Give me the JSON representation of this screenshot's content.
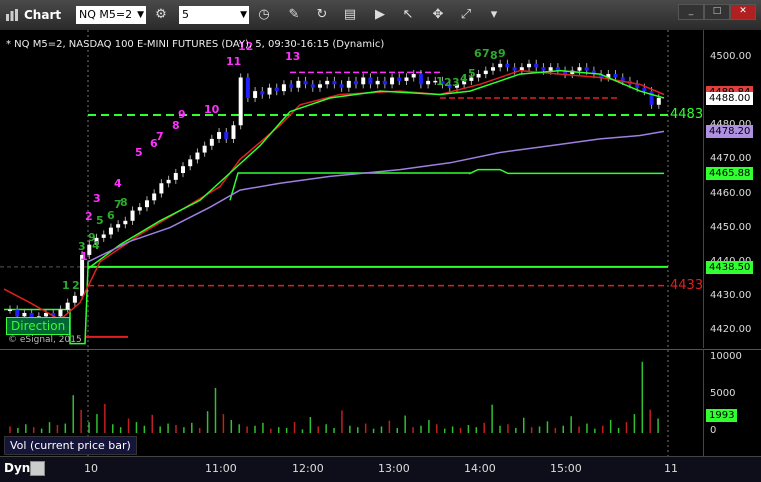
{
  "window": {
    "title": "Chart",
    "symbol": "NQ M5=2",
    "interval": "5"
  },
  "chart": {
    "header": "* NQ M5=2, NASDAQ 100 E-MINI FUTURES (DAY), 5, 09:30-16:15 (Dynamic)",
    "direction_button": "Direction",
    "copyright": "© eSignal, 2015",
    "price_ticks": [
      "4500.00",
      "4490.00",
      "4480.00",
      "4470.00",
      "4460.00",
      "4450.00",
      "4440.00",
      "4430.00",
      "4420.00"
    ],
    "price_badges": [
      {
        "text": "4489.84",
        "color": "#e04040",
        "price": 4489.84
      },
      {
        "text": "4488.00",
        "color": "#ffffff",
        "price": 4488.0
      },
      {
        "text": "4478.20",
        "color": "#b090e0",
        "price": 4478.2
      },
      {
        "text": "4465.88",
        "color": "#30ff30",
        "price": 4465.88
      },
      {
        "text": "4438.50",
        "color": "#30ff30",
        "price": 4438.5
      }
    ],
    "level_labels": [
      {
        "text": "4483",
        "color": "#30ff30",
        "price": 4483
      },
      {
        "text": "4433",
        "color": "#e02020",
        "price": 4433
      }
    ],
    "time_labels": [
      "10",
      "11:00",
      "12:00",
      "13:00",
      "14:00",
      "15:00",
      "11"
    ],
    "magenta_counts": [
      "1",
      "2",
      "3",
      "4",
      "5",
      "6",
      "7",
      "8",
      "9",
      "10",
      "11",
      "12",
      "13"
    ],
    "green_counts_a": [
      "1",
      "2",
      "3",
      "4",
      "5",
      "6",
      "7",
      "8",
      "9"
    ],
    "green_counts_b": [
      "1",
      "2",
      "3",
      "4",
      "5",
      "6",
      "7",
      "8",
      "9"
    ]
  },
  "volume": {
    "label": "Vol (current price bar)",
    "ticks": [
      "10000",
      "5000",
      "0"
    ],
    "current": "1993"
  },
  "bottom": {
    "dyn": "Dyn"
  },
  "colors": {
    "up": "#ffffff",
    "down": "#2020ff",
    "green": "#30ff30",
    "red": "#e02020",
    "purple": "#9f7fdf",
    "magenta": "#ff30ff"
  }
}
